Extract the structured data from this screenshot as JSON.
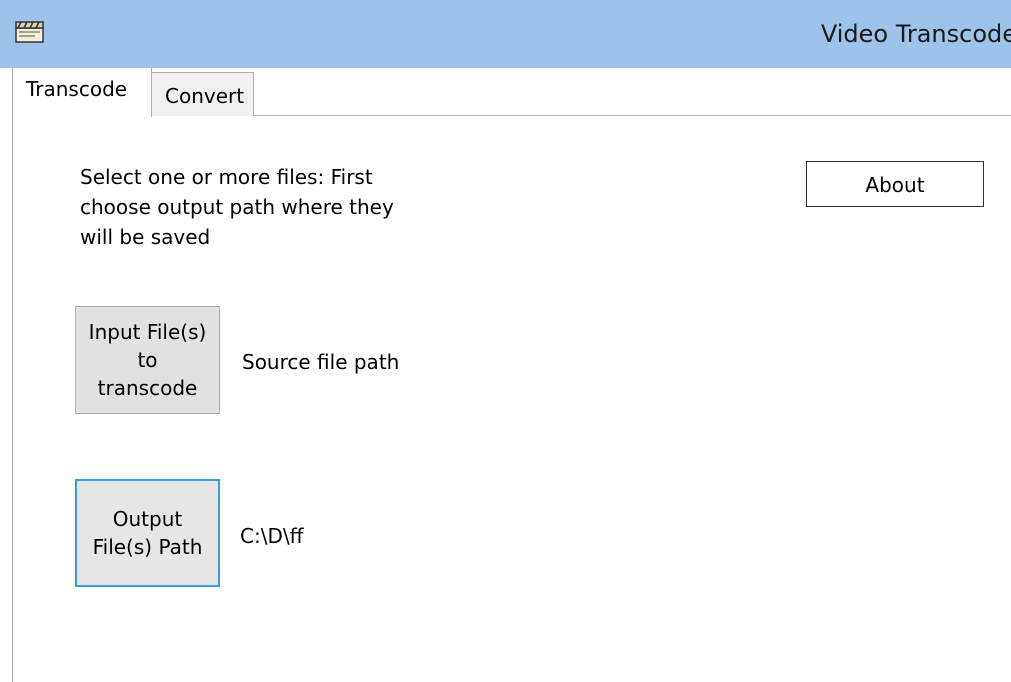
{
  "window": {
    "title": "Video Transcode",
    "icon": "clapperboard-icon"
  },
  "tabs": [
    {
      "label": "Transcode",
      "active": true
    },
    {
      "label": "Convert",
      "active": false
    }
  ],
  "transcode": {
    "instructions": "Select one or more files: First choose output path where they will be saved",
    "about_label": "About",
    "input_button_label": "Input File(s) to transcode",
    "source_path": "Source file path",
    "output_button_label": "Output File(s) Path",
    "output_path": "C:\\D\\ff"
  },
  "colors": {
    "titlebar": "#9ec3ea",
    "button_face": "#e1e1e1",
    "focus_border": "#35a3dd"
  }
}
